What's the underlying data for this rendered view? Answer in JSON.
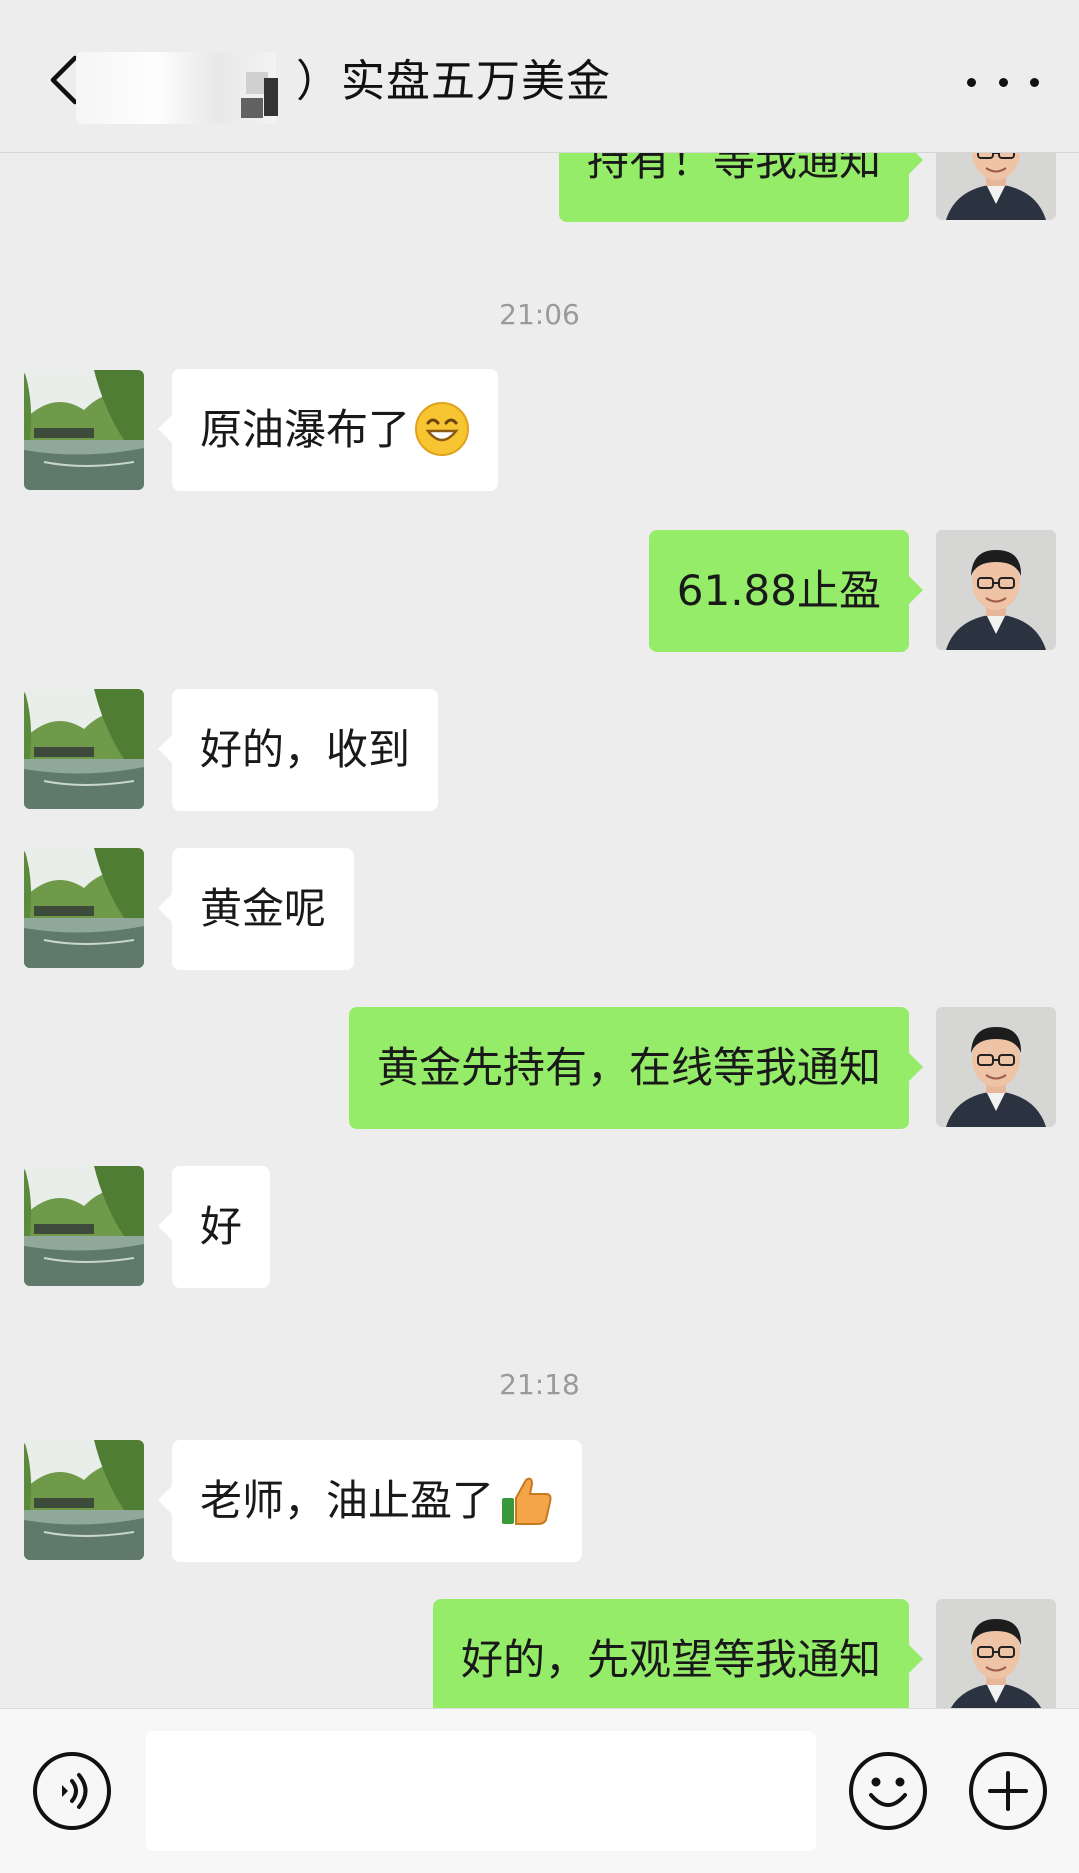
{
  "header": {
    "title": "）实盘五万美金",
    "back_icon": "chevron-left-icon",
    "more_icon": "ellipsis-icon"
  },
  "messages": [
    {
      "side": "right",
      "text": "持有！等我通知",
      "partial": true
    },
    {
      "timestamp": "21:06"
    },
    {
      "side": "left",
      "text": "原油瀑布了",
      "emoji": "grinning-face-icon"
    },
    {
      "side": "right",
      "text": "61.88止盈"
    },
    {
      "side": "left",
      "text": "好的，收到"
    },
    {
      "side": "left",
      "text": "黄金呢"
    },
    {
      "side": "right",
      "text": "黄金先持有，在线等我通知"
    },
    {
      "side": "left",
      "text": "好"
    },
    {
      "timestamp": "21:18"
    },
    {
      "side": "left",
      "text": "老师，油止盈了",
      "emoji": "thumbs-up-icon"
    },
    {
      "side": "right",
      "text": "好的，先观望等我通知"
    }
  ],
  "input_bar": {
    "voice_icon": "voice-icon",
    "emoji_icon": "emoji-icon",
    "plus_icon": "plus-icon",
    "input_value": ""
  },
  "colors": {
    "background": "#ededed",
    "bubble_self": "#95ec69",
    "bubble_other": "#ffffff",
    "timestamp": "#9a9a9a"
  }
}
